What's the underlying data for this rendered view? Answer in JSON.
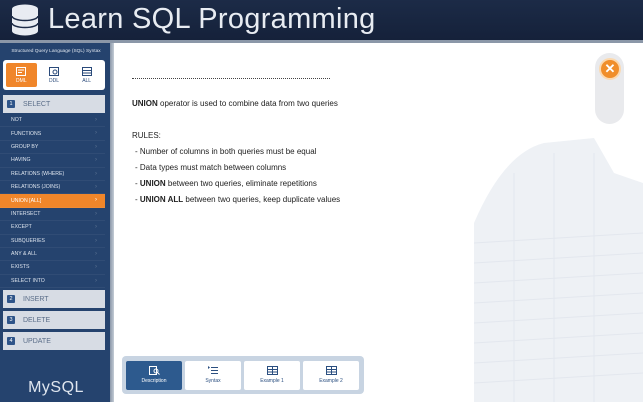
{
  "header": {
    "title": "Learn SQL Programming",
    "logo_icon": "database-icon"
  },
  "sidebar": {
    "heading": "Structured Query Language (SQL) Syntax",
    "type_tabs": [
      {
        "label": "DML",
        "icon": "dml-icon",
        "active": true
      },
      {
        "label": "DDL",
        "icon": "ddl-icon",
        "active": false
      },
      {
        "label": "ALL",
        "icon": "all-icon",
        "active": false
      }
    ],
    "sections": [
      {
        "num": "1",
        "label": "SELECT"
      },
      {
        "num": "2",
        "label": "INSERT"
      },
      {
        "num": "3",
        "label": "DELETE"
      },
      {
        "num": "4",
        "label": "UPDATE"
      }
    ],
    "select_items": [
      "NOT",
      "FUNCTIONS",
      "GROUP BY",
      "HAVING",
      "RELATIONS (WHERE)",
      "RELATIONS (JOINS)",
      "UNION [ALL]",
      "INTERSECT",
      "EXCEPT",
      "SUBQUERIES",
      "ANY  &  ALL",
      "EXISTS",
      "SELECT INTO"
    ],
    "active_item": "UNION [ALL]",
    "footer": "MySQL"
  },
  "content": {
    "intro_bold": "UNION",
    "intro_rest": " operator is used to combine data from two queries",
    "rules_title": "RULES:",
    "rule1": "-  Number of columns in both queries must be equal",
    "rule2": "-  Data types must match between columns",
    "rule3_prefix": "-  ",
    "rule3_bold": "UNION",
    "rule3_rest": " between two queries, eliminate repetitions",
    "rule4_prefix": "-  ",
    "rule4_bold": "UNION ALL",
    "rule4_rest": " between two queries, keep duplicate values"
  },
  "bottom_tabs": [
    {
      "label": "Description",
      "icon": "search-document-icon",
      "active": true
    },
    {
      "label": "Syntax",
      "icon": "list-icon",
      "active": false
    },
    {
      "label": "Example 1",
      "icon": "table-icon",
      "active": false
    },
    {
      "label": "Example 2",
      "icon": "table-icon",
      "active": false
    }
  ],
  "colors": {
    "accent": "#f0862a",
    "navy": "#1c2b47",
    "sidebar": "#25436e",
    "active_tab": "#2d5a8e"
  }
}
